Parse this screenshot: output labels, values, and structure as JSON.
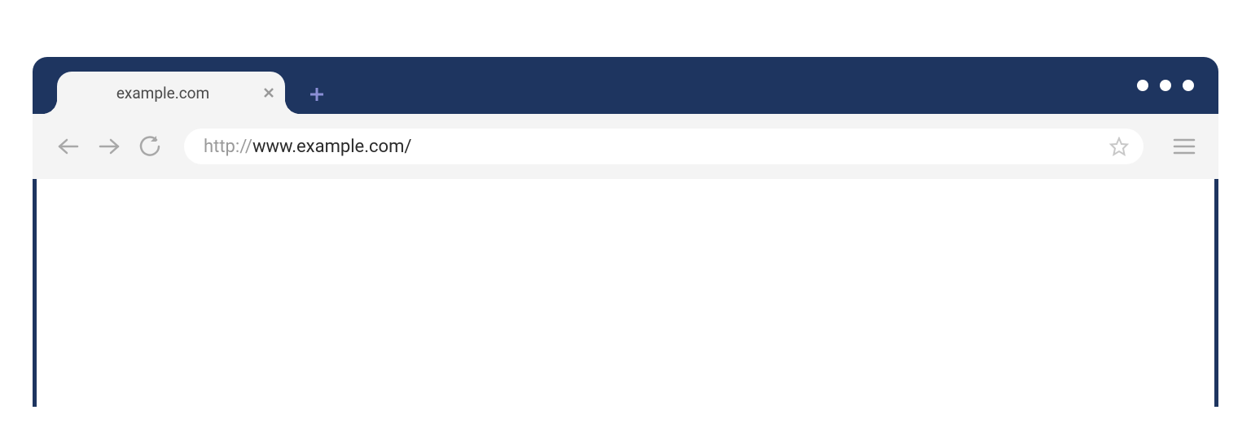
{
  "tabs": [
    {
      "title": "example.com"
    }
  ],
  "address": {
    "protocol": "http://",
    "rest": "www.example.com/"
  },
  "colors": {
    "chrome": "#1e3560",
    "toolbar": "#f4f4f4"
  }
}
